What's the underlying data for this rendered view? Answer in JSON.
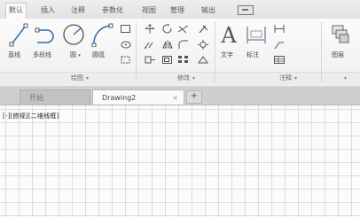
{
  "ribbon_tabs": [
    {
      "label": "默认",
      "active": true
    },
    {
      "label": "插入",
      "active": false
    },
    {
      "label": "注释",
      "active": false
    },
    {
      "label": "参数化",
      "active": false
    },
    {
      "label": "视图",
      "active": false
    },
    {
      "label": "管理",
      "active": false
    },
    {
      "label": "输出",
      "active": false
    }
  ],
  "draw_panel": {
    "title": "绘图",
    "tools": {
      "line": "直线",
      "polyline": "多段线",
      "circle": "圆",
      "arc": "圆弧"
    }
  },
  "modify_panel": {
    "title": "修改"
  },
  "annotation_panel": {
    "title": "注释",
    "tools": {
      "text": "文字",
      "dimension": "标注"
    }
  },
  "layers": {
    "label": "图层"
  },
  "document_tabs": {
    "start": "开始",
    "drawing": "Drawing2",
    "close_glyph": "×",
    "add_glyph": "+"
  },
  "viewport": {
    "label": "[-][俯视][二维线框]"
  }
}
